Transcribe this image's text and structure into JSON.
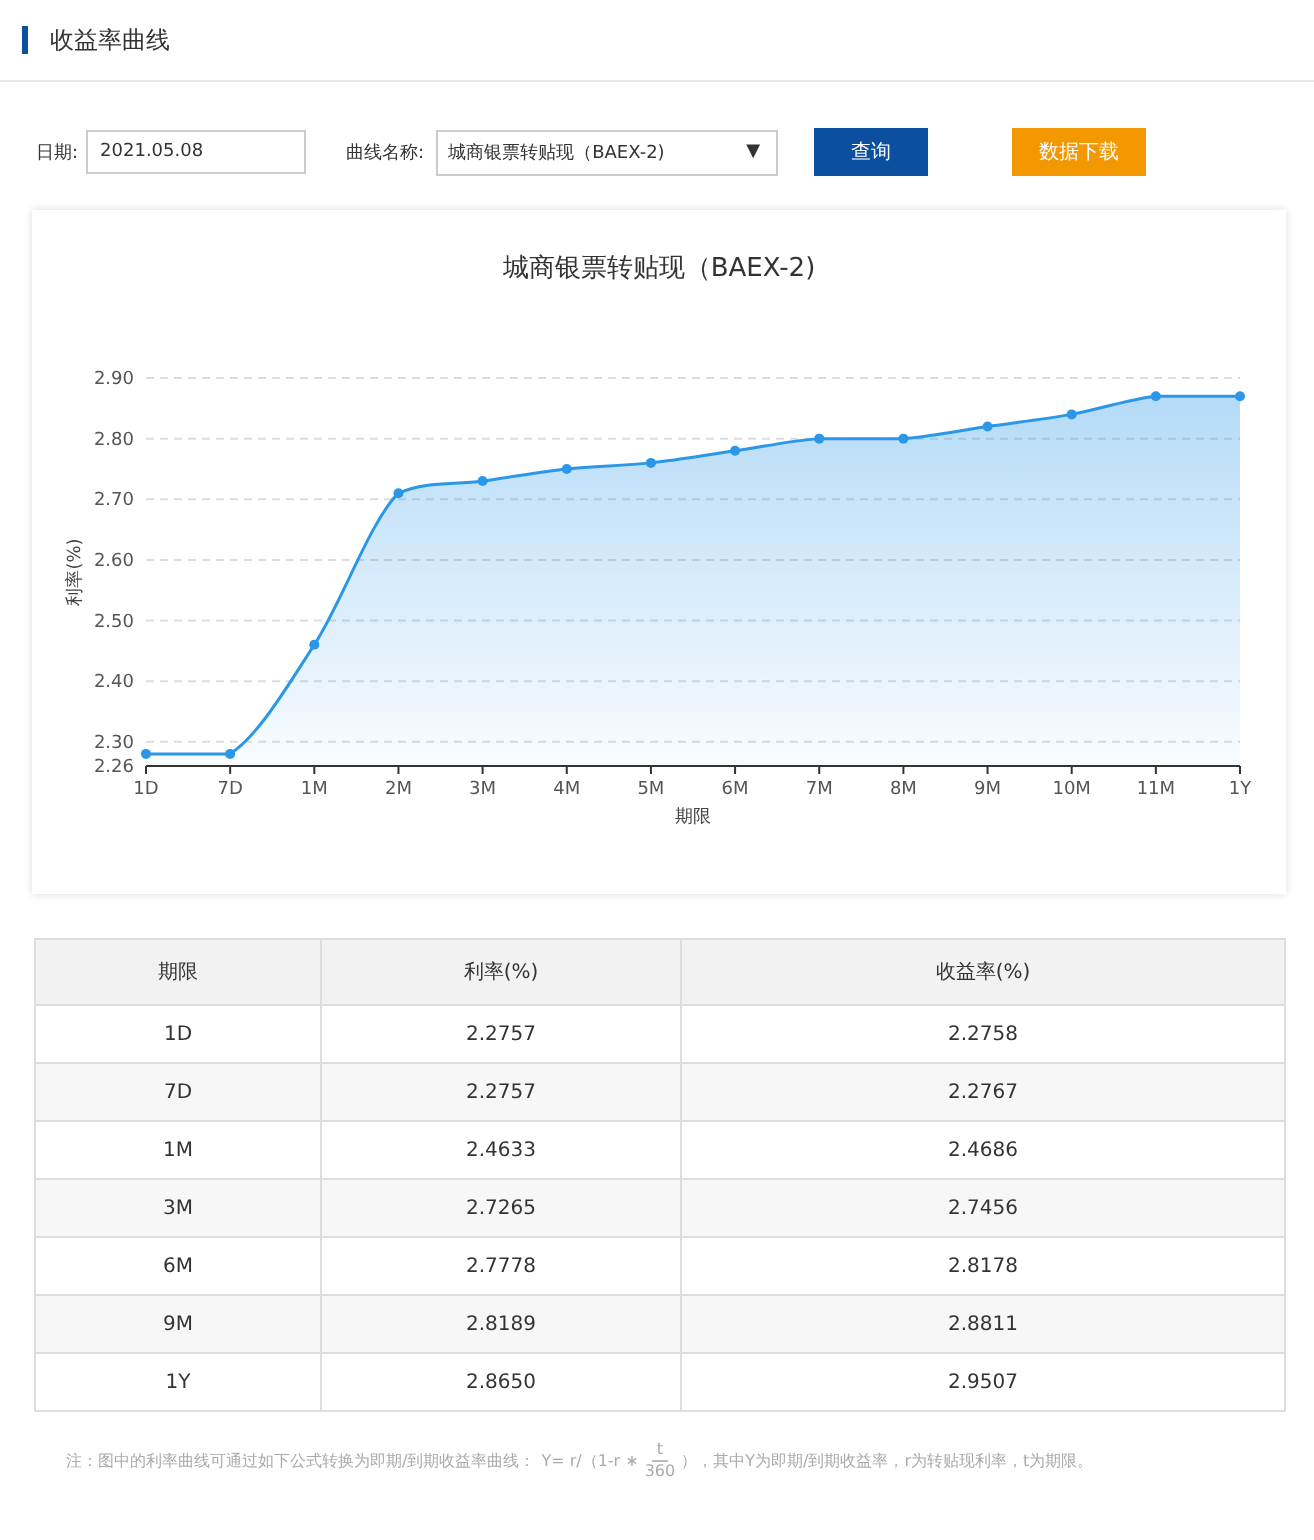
{
  "page_title": "收益率曲线",
  "filters": {
    "date_label": "日期:",
    "date_value": "2021.05.08",
    "curve_label": "曲线名称:",
    "curve_value": "城商银票转贴现（BAEX-2)",
    "caret": "▼",
    "query_button": "查询",
    "download_button": "数据下载"
  },
  "chart": {
    "chart_data": {
      "type": "area",
      "title": "城商银票转贴现（BAEX-2)",
      "xlabel": "期限",
      "ylabel": "利率(%)",
      "categories": [
        "1D",
        "7D",
        "1M",
        "2M",
        "3M",
        "4M",
        "5M",
        "6M",
        "7M",
        "8M",
        "9M",
        "10M",
        "11M",
        "1Y"
      ],
      "series": [
        {
          "color": "#2a97e8",
          "values": [
            2.28,
            2.28,
            2.46,
            2.71,
            2.73,
            2.75,
            2.76,
            2.78,
            2.8,
            2.8,
            2.82,
            2.84,
            2.87,
            2.87
          ]
        }
      ],
      "ylim": [
        2.26,
        2.9
      ],
      "grid": true,
      "yticks": [
        {
          "value": 2.26,
          "label": "2.26"
        },
        {
          "value": 2.3,
          "label": "2.30"
        },
        {
          "value": 2.4,
          "label": "2.40"
        },
        {
          "value": 2.5,
          "label": "2.50"
        },
        {
          "value": 2.6,
          "label": "2.60"
        },
        {
          "value": 2.7,
          "label": "2.70"
        },
        {
          "value": 2.8,
          "label": "2.80"
        },
        {
          "value": 2.9,
          "label": "2.90"
        }
      ]
    }
  },
  "table": {
    "columns": [
      "期限",
      "利率(%)",
      "收益率(%)"
    ],
    "rows": [
      [
        "1D",
        "2.2757",
        "2.2758"
      ],
      [
        "7D",
        "2.2757",
        "2.2767"
      ],
      [
        "1M",
        "2.4633",
        "2.4686"
      ],
      [
        "3M",
        "2.7265",
        "2.7456"
      ],
      [
        "6M",
        "2.7778",
        "2.8178"
      ],
      [
        "9M",
        "2.8189",
        "2.8811"
      ],
      [
        "1Y",
        "2.8650",
        "2.9507"
      ]
    ]
  },
  "note": {
    "lead": "注：图中的利率曲线可通过如下公式转换为即期/到期收益率曲线：",
    "formula_lead": "Y= r/（1-r ∗",
    "numerator": "t",
    "denominator": "360",
    "formula_tail": "），",
    "tail": "其中Y为即期/到期收益率，r为转贴现利率，t为期限。"
  }
}
